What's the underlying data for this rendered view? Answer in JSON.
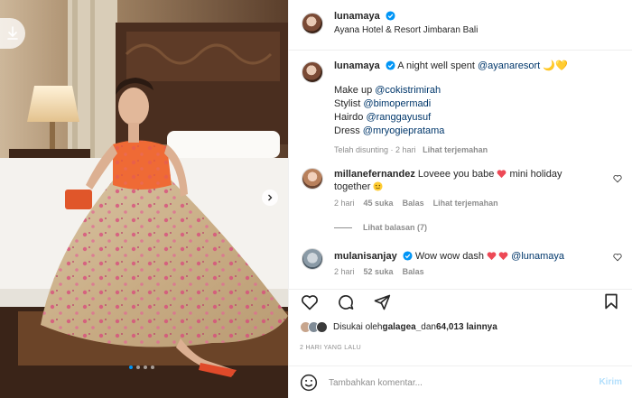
{
  "post": {
    "username": "lunamaya",
    "location": "Ayana Hotel & Resort Jimbaran Bali"
  },
  "caption": {
    "username": "lunamaya",
    "line1_text": "A night well spent ",
    "line1_mention": "@ayanaresort",
    "line1_emoji": "🌙💛",
    "credits": [
      {
        "role": "Make up ",
        "mention": "@cokistrimirah"
      },
      {
        "role": "Stylist ",
        "mention": "@bimopermadi"
      },
      {
        "role": "Hairdo ",
        "mention": "@ranggayusuf"
      },
      {
        "role": "Dress ",
        "mention": "@mryogiepratama"
      }
    ],
    "meta_edited": "Telah disunting",
    "meta_time": "2 hari",
    "meta_translate": "Lihat terjemahan"
  },
  "comments": [
    {
      "username": "millanefernandez",
      "text_a": "Loveee you babe ",
      "text_b": " mini holiday",
      "text_c": "together ",
      "time": "2 hari",
      "likes": "45 suka",
      "reply": "Balas",
      "translate": "Lihat terjemahan",
      "view_replies": "Lihat balasan (7)"
    },
    {
      "username": "mulanisanjay",
      "text_a": "Wow wow dash ",
      "mention": "@lunamaya",
      "time": "2 hari",
      "likes": "52 suka",
      "reply": "Balas"
    }
  ],
  "likes": {
    "prefix": "Disukai oleh ",
    "user": "galagea_",
    "middle": " dan ",
    "count": "64,013 lainnya"
  },
  "date": "2 HARI YANG LALU",
  "comment_box": {
    "placeholder": "Tambahkan komentar...",
    "post_label": "Kirim"
  },
  "colors": {
    "link": "#00376b",
    "verified": "#0095f6",
    "heart": "#ed4956",
    "post_disabled": "#b2dffc"
  },
  "icons": {
    "download": "download-icon",
    "next": "chevron-right-icon",
    "like": "heart-icon",
    "comment": "comment-icon",
    "share": "paper-plane-icon",
    "save": "bookmark-icon",
    "emoji": "smiley-icon"
  },
  "carousel": {
    "slides": 4,
    "active": 1
  }
}
